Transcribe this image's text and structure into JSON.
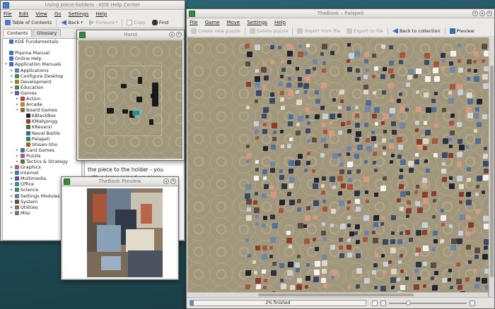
{
  "help": {
    "title": "Using piece-holders - KDE Help Center",
    "menu": [
      "File",
      "Edit",
      "View",
      "Go",
      "Settings",
      "Help"
    ],
    "toolbar": {
      "toc": "Table of Contents",
      "back": "Back",
      "forward": "Forward",
      "copy": "Copy",
      "find": "Find"
    },
    "tabs": [
      "Contents",
      "Glossary"
    ],
    "tree": [
      {
        "l": "KDE Fundamentals",
        "d": 0,
        "c": "#3b6fc4"
      },
      {
        "l": "",
        "d": 0,
        "c": ""
      },
      {
        "l": "Plasma Manual",
        "d": 0,
        "c": "#3b6fc4"
      },
      {
        "l": "Online Help",
        "d": 0,
        "c": "#3b6fc4"
      },
      {
        "l": "Application Manuals",
        "d": 0,
        "c": "#3b6fc4",
        "ar": "▾"
      },
      {
        "l": "Applications",
        "d": 1,
        "c": "#5a7fb0",
        "ar": "▸"
      },
      {
        "l": "Configure Desktop",
        "d": 1,
        "c": "#4a8a4a",
        "ar": "▸"
      },
      {
        "l": "Development",
        "d": 1,
        "c": "#b07a2a",
        "ar": "▸"
      },
      {
        "l": "Education",
        "d": 1,
        "c": "#3b8a6a",
        "ar": "▸"
      },
      {
        "l": "Games",
        "d": 1,
        "c": "#6a5aa0",
        "ar": "▾"
      },
      {
        "l": "Action",
        "d": 2,
        "c": "#c04040",
        "ar": "▸"
      },
      {
        "l": "Arcade",
        "d": 2,
        "c": "#c08030",
        "ar": "▸"
      },
      {
        "l": "Board Games",
        "d": 2,
        "c": "#8a6a3a",
        "ar": "▾"
      },
      {
        "l": "KBlackBox",
        "d": 3,
        "c": "#222",
        "sel": true
      },
      {
        "l": "KMahjongg",
        "d": 3,
        "c": "#a33"
      },
      {
        "l": "KReversi",
        "d": 3,
        "c": "#3a7a3a"
      },
      {
        "l": "Naval Battle",
        "d": 3,
        "c": "#3a6aa0"
      },
      {
        "l": "Palapeli",
        "d": 3,
        "c": "#2f8f3a"
      },
      {
        "l": "Shisen-Sho",
        "d": 3,
        "c": "#b05a2a"
      },
      {
        "l": "Card Games",
        "d": 2,
        "c": "#4a6a9a",
        "ar": "▸"
      },
      {
        "l": "Puzzle",
        "d": 2,
        "c": "#9a5a9a",
        "ar": "▸"
      },
      {
        "l": "Tactics & Strategy",
        "d": 2,
        "c": "#6a6a3a",
        "ar": "▸"
      },
      {
        "l": "Graphics",
        "d": 1,
        "c": "#c05a5a",
        "ar": "▸"
      },
      {
        "l": "Internet",
        "d": 1,
        "c": "#3a7ac0",
        "ar": "▸"
      },
      {
        "l": "Multimedia",
        "d": 1,
        "c": "#6a4a9a",
        "ar": "▸"
      },
      {
        "l": "Office",
        "d": 1,
        "c": "#3a8aa0",
        "ar": "▸"
      },
      {
        "l": "Science",
        "d": 1,
        "c": "#4a8a4a",
        "ar": "▸"
      },
      {
        "l": "Settings Modules",
        "d": 1,
        "c": "#5a7fb0",
        "ar": "▸"
      },
      {
        "l": "System",
        "d": 1,
        "c": "#555",
        "ar": "▸"
      },
      {
        "l": "Utilities",
        "d": 1,
        "c": "#8a7a3a",
        "ar": "▸"
      },
      {
        "l": "Misc",
        "d": 1,
        "c": "#777",
        "ar": "▸"
      }
    ],
    "doc_lines": [
      "the piece to the holder - you",
      "with a large joined-up piece"
    ]
  },
  "palapeli": {
    "title": "TheBook – Palapeli",
    "menu": [
      "File",
      "Game",
      "Move",
      "Settings",
      "Help"
    ],
    "toolbar": {
      "create": "Create new puzzle",
      "delete": "Delete puzzle",
      "import": "Import from file",
      "export": "Export to file",
      "back": "Back to collection",
      "preview": "Preview"
    },
    "progress": {
      "text": "2% finished",
      "value": 0.02
    }
  },
  "hand": {
    "title": "Hand"
  },
  "preview": {
    "title": "TheBook Preview"
  },
  "colors": {
    "board": "#a0977c",
    "accent": "#5b8fc7"
  }
}
